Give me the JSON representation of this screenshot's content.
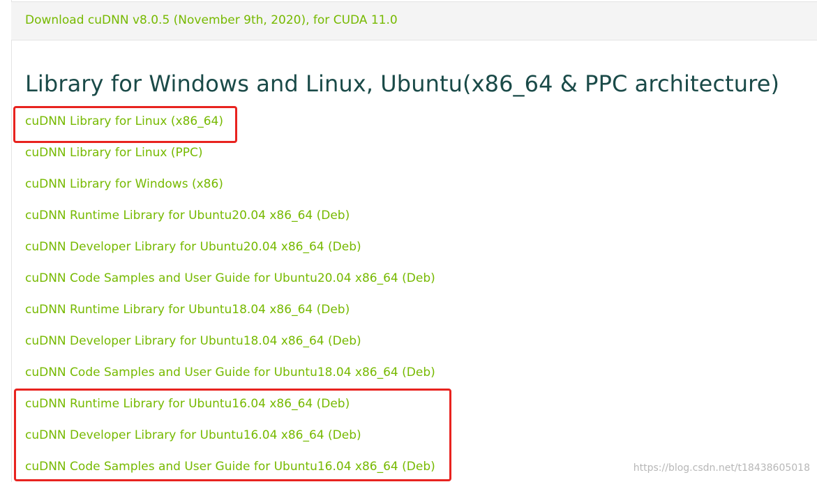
{
  "header": {
    "download_label": "Download cuDNN v8.0.5 (November 9th, 2020), for CUDA 11.0"
  },
  "section": {
    "title": "Library for Windows and Linux, Ubuntu(x86_64 & PPC architecture)"
  },
  "links": [
    "cuDNN Library for Linux (x86_64)",
    "cuDNN Library for Linux (PPC)",
    "cuDNN Library for Windows (x86)",
    "cuDNN Runtime Library for Ubuntu20.04 x86_64 (Deb)",
    "cuDNN Developer Library for Ubuntu20.04 x86_64 (Deb)",
    "cuDNN Code Samples and User Guide for Ubuntu20.04 x86_64 (Deb)",
    "cuDNN Runtime Library for Ubuntu18.04 x86_64 (Deb)",
    "cuDNN Developer Library for Ubuntu18.04 x86_64 (Deb)",
    "cuDNN Code Samples and User Guide for Ubuntu18.04 x86_64 (Deb)",
    "cuDNN Runtime Library for Ubuntu16.04 x86_64 (Deb)",
    "cuDNN Developer Library for Ubuntu16.04 x86_64 (Deb)",
    "cuDNN Code Samples and User Guide for Ubuntu16.04 x86_64 (Deb)"
  ],
  "watermark": "https://blog.csdn.net/t18438605018",
  "colors": {
    "link": "#76b900",
    "title": "#1a4a48",
    "highlight": "#e8231f",
    "header_bg": "#f4f4f4"
  }
}
